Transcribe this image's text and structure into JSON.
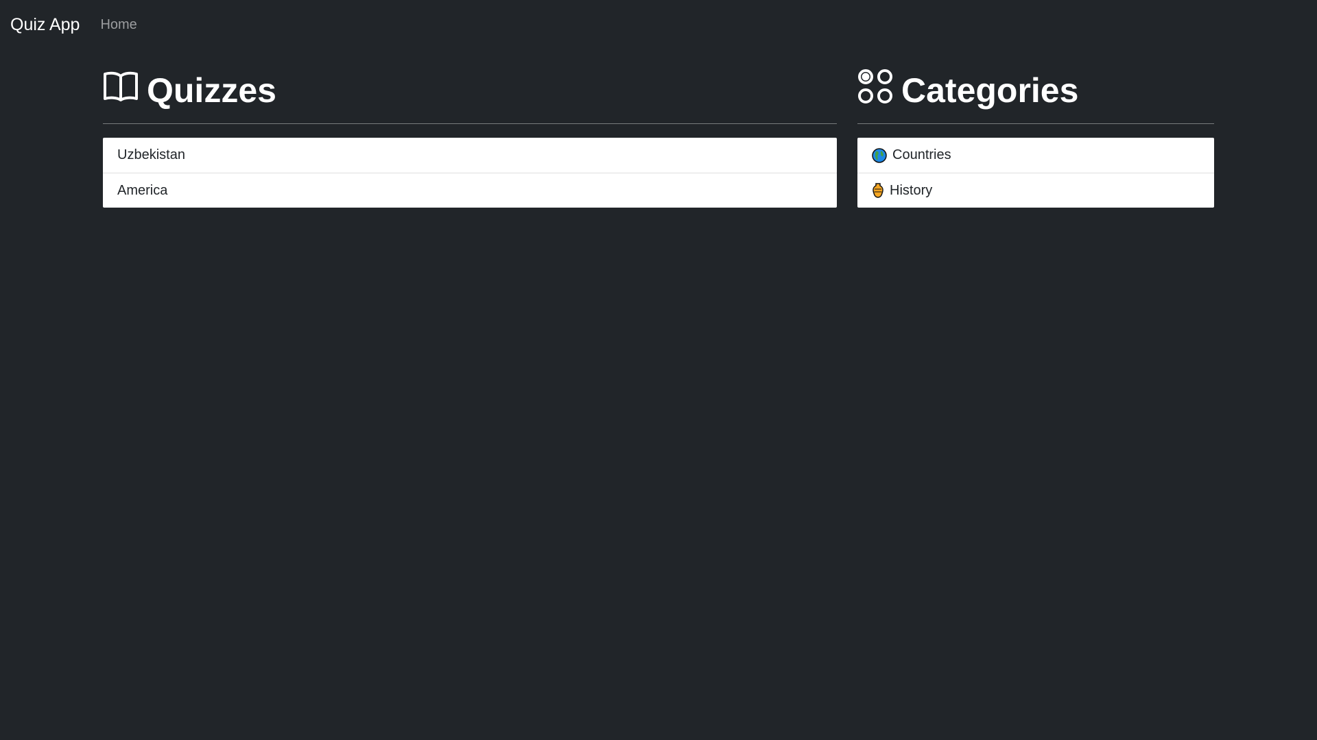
{
  "navbar": {
    "brand": "Quiz App",
    "links": [
      {
        "label": "Home"
      }
    ]
  },
  "quizzes": {
    "title": "Quizzes",
    "icon": "book-icon",
    "items": [
      {
        "label": "Uzbekistan"
      },
      {
        "label": "America"
      }
    ]
  },
  "categories": {
    "title": "Categories",
    "icon": "circles-grid-icon",
    "items": [
      {
        "label": "Countries",
        "icon": "globe-icon"
      },
      {
        "label": "History",
        "icon": "amphora-icon"
      }
    ]
  },
  "colors": {
    "background": "#212529",
    "list_background": "#ffffff",
    "text_dark": "#212529"
  }
}
